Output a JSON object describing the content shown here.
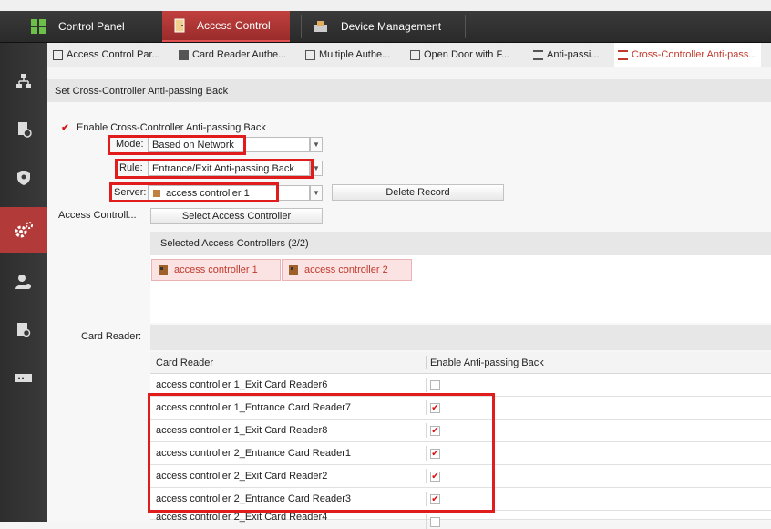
{
  "top_tabs": [
    {
      "label": "Control Panel",
      "icon": "grid-icon"
    },
    {
      "label": "Access Control",
      "icon": "door-icon",
      "active": true
    },
    {
      "label": "Device Management",
      "icon": "device-icon"
    }
  ],
  "sub_tabs": [
    {
      "label": "Access Control Par..."
    },
    {
      "label": "Card Reader Authe..."
    },
    {
      "label": "Multiple Authe..."
    },
    {
      "label": "Open Door with F..."
    },
    {
      "label": "Anti-passi..."
    },
    {
      "label": "Cross-Controller Anti-pass...",
      "active": true
    }
  ],
  "section_title": "Set Cross-Controller Anti-passing Back",
  "enable_label": "Enable Cross-Controller Anti-passing Back",
  "mode": {
    "label": "Mode:",
    "value": "Based on Network"
  },
  "rule": {
    "label": "Rule:",
    "value": "Entrance/Exit Anti-passing Back"
  },
  "server": {
    "label": "Server:",
    "value": "access controller 1"
  },
  "delete_record": "Delete Record",
  "access_controller_label": "Access Controll...",
  "select_access_controller": "Select Access Controller",
  "selected_header": "Selected Access Controllers (2/2)",
  "selected_controllers": [
    "access controller 1",
    "access controller 2"
  ],
  "card_reader_label": "Card Reader:",
  "grid": {
    "col1": "Card Reader",
    "col2": "Enable Anti-passing Back",
    "rows": [
      {
        "name": "access controller 1_Exit Card Reader6",
        "checked": false
      },
      {
        "name": "access controller 1_Entrance Card Reader7",
        "checked": true
      },
      {
        "name": "access controller 1_Exit Card Reader8",
        "checked": true
      },
      {
        "name": "access controller 2_Entrance Card Reader1",
        "checked": true
      },
      {
        "name": "access controller 2_Exit Card Reader2",
        "checked": true
      },
      {
        "name": "access controller 2_Entrance Card Reader3",
        "checked": true
      },
      {
        "name": "access controller 2_Exit Card Reader4",
        "checked": false
      }
    ]
  },
  "colors": {
    "accent": "#b23a38",
    "highlight": "#e11c1c"
  }
}
